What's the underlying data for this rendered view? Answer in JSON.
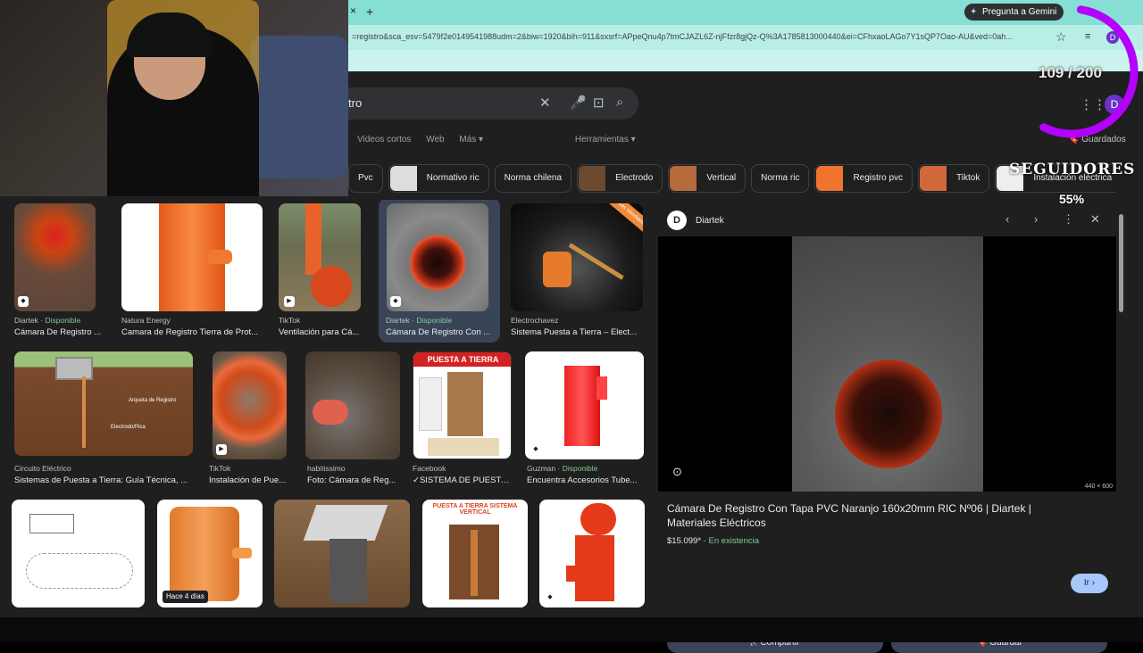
{
  "browser": {
    "tab_close": "×",
    "new_tab": "+",
    "gemini_button": "Pregunta a Gemini",
    "url": "=registro&sca_esv=5479f2e0149541988udm=2&biw=1920&bih=911&sxsrf=APpeQnu4p7tmCJAZL6Z-njFfzr8gjQz-Q%3A1785813000440&ei=CFhxaoLAGo7Y1sQP7Oao-AU&ved=0ah...",
    "profile_initial": "D"
  },
  "search": {
    "query": "tro",
    "profile_initial": "D",
    "filters": [
      "Videos cortos",
      "Web",
      "Más ▾",
      "Herramientas ▾"
    ],
    "saved_label": "Guardados"
  },
  "chips": [
    {
      "label": "Pvc",
      "thumb": false
    },
    {
      "label": "Normativo ric",
      "thumb": true,
      "color": "#ddd"
    },
    {
      "label": "Norma chilena",
      "thumb": false
    },
    {
      "label": "Electrodo",
      "thumb": true,
      "color": "#6b4a30"
    },
    {
      "label": "Vertical",
      "thumb": true,
      "color": "#b76a3a"
    },
    {
      "label": "Norma ric",
      "thumb": false
    },
    {
      "label": "Registro pvc",
      "thumb": true,
      "color": "#f0742f"
    },
    {
      "label": "Tiktok",
      "thumb": true,
      "color": "#d1683a"
    },
    {
      "label": "Instalación eléctrica",
      "thumb": true,
      "color": "#eee"
    }
  ],
  "results": [
    {
      "source": "Diartek · ",
      "avail": "Disponible",
      "title": "Cámara De Registro ..."
    },
    {
      "source": "Natura Energy",
      "avail": "",
      "title": "Camara de Registro Tierra de Prot..."
    },
    {
      "source": "TikTok",
      "avail": "",
      "title": "Ventilación para Cá..."
    },
    {
      "source": "Diartek · ",
      "avail": "Disponible",
      "title": "Cámara De Registro Con ..."
    },
    {
      "source": "Electrochavez",
      "avail": "",
      "title": "Sistema Puesta a Tierra – Elect..."
    },
    {
      "source": "Circuito Eléctrico",
      "avail": "",
      "title": "Sistemas de Puesta a Tierra: Guía Técnica, ..."
    },
    {
      "source": "TikTok",
      "avail": "",
      "title": "Instalación de Pue..."
    },
    {
      "source": "habitissimo",
      "avail": "",
      "title": "Foto: Cámara de Reg..."
    },
    {
      "source": "Facebook",
      "avail": "",
      "title": "✓SISTEMA DE PUESTA..."
    },
    {
      "source": "Guzman · ",
      "avail": "Disponible",
      "title": "Encuentra Accesorios Tube..."
    }
  ],
  "result_labels": {
    "puesta": "PUESTA A TIERRA",
    "sistema_vertical": "PUESTA A TIERRA SISTEMA VERTICAL",
    "hace": "Hace 4 días",
    "promo": "Más Vendidos",
    "thumb_label": "Arqueta de Registro",
    "thumb_label2": "Electrodo/Pica"
  },
  "panel": {
    "site": "Diartek",
    "site_initial": "D",
    "title": "Cámara De Registro Con Tapa PVC Naranjo 160x20mm RIC Nº06 | Diartek | Materiales Eléctricos",
    "price": "$15.099*",
    "stock": "En existencia",
    "visit_label": "Ir",
    "share_label": "Compartir",
    "save_label": "Guardar",
    "dimensions": "440 × 600"
  },
  "overlay": {
    "counter": "109 / 200",
    "followers_label": "SEGUIDORES",
    "percent": "55%"
  },
  "colors": {
    "accent": "#a8c7fa",
    "available": "#81c995",
    "progress_ring": "#b400ff"
  },
  "progress": {
    "followers_fraction": 0.55
  }
}
